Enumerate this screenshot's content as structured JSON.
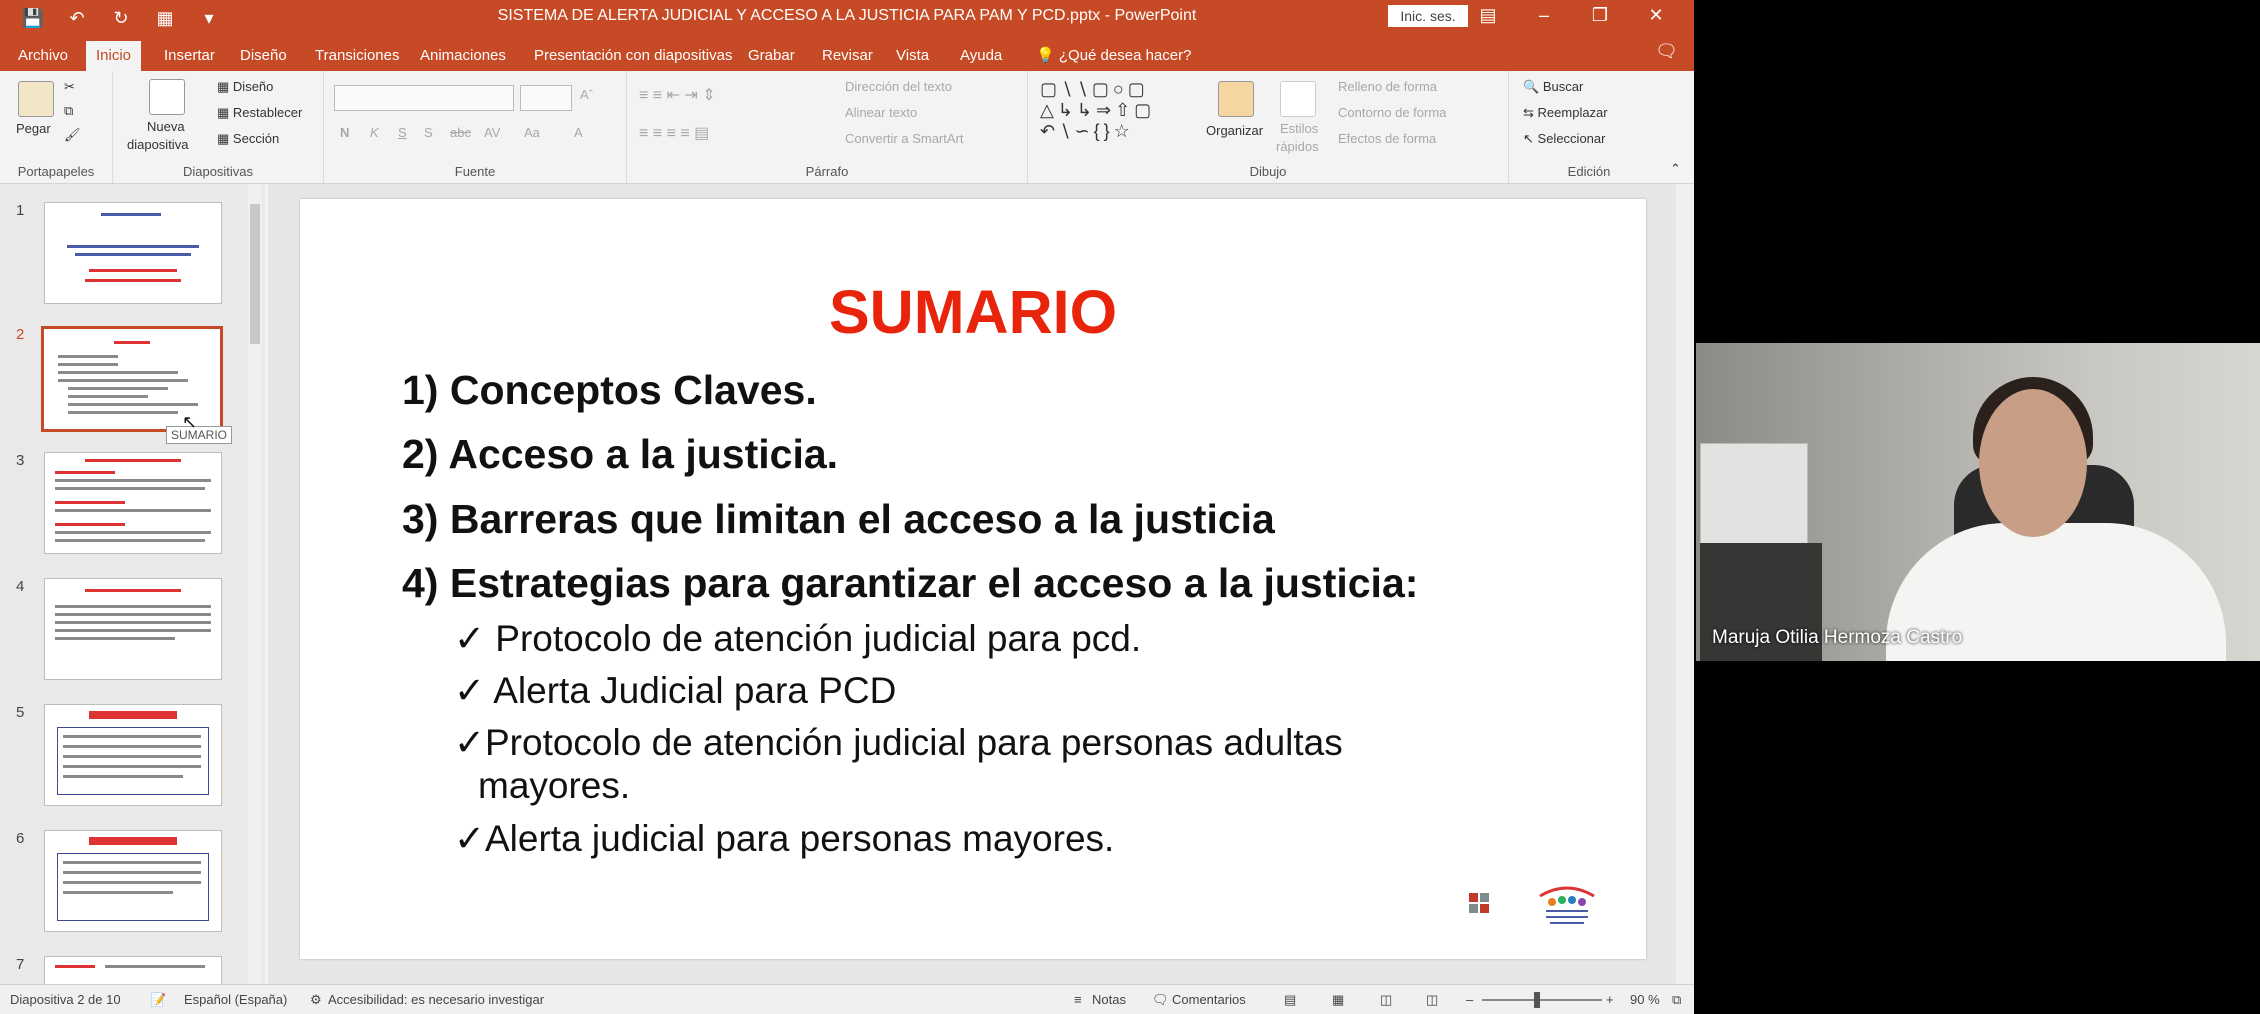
{
  "window": {
    "title": "SISTEMA DE ALERTA JUDICIAL Y ACCESO A LA JUSTICIA PARA PAM Y  PCD.pptx  -  PowerPoint",
    "signin": "Inic. ses.",
    "qat_icons": [
      "save-icon",
      "undo-icon",
      "redo-icon",
      "start-slideshow-icon",
      "customize-icon"
    ]
  },
  "tabs": {
    "items": [
      "Archivo",
      "Inicio",
      "Insertar",
      "Diseño",
      "Transiciones",
      "Animaciones",
      "Presentación con diapositivas",
      "Grabar",
      "Revisar",
      "Vista",
      "Ayuda"
    ],
    "active": "Inicio",
    "tell_me": "¿Qué desea hacer?"
  },
  "ribbon": {
    "portapapeles": {
      "label": "Portapapeles",
      "paste": "Pegar"
    },
    "diapositivas": {
      "label": "Diapositivas",
      "new_slide_1": "Nueva",
      "new_slide_2": "diapositiva",
      "layout": "Diseño",
      "reset": "Restablecer",
      "section": "Sección"
    },
    "fuente": {
      "label": "Fuente",
      "buttons": [
        "N",
        "K",
        "S",
        "S",
        "abc",
        "AV",
        "Aa",
        "A"
      ]
    },
    "parrafo": {
      "label": "Párrafo",
      "direction": "Dirección del texto",
      "align": "Alinear texto",
      "smartart": "Convertir a SmartArt"
    },
    "dibujo": {
      "label": "Dibujo",
      "arrange": "Organizar",
      "styles_1": "Estilos",
      "styles_2": "rápidos",
      "fill": "Relleno de forma",
      "outline": "Contorno de forma",
      "effects": "Efectos de forma"
    },
    "edicion": {
      "label": "Edición",
      "find": "Buscar",
      "replace": "Reemplazar",
      "select": "Seleccionar"
    }
  },
  "thumbnails": {
    "numbers": [
      "1",
      "2",
      "3",
      "4",
      "5",
      "6",
      "7"
    ],
    "selected": 2,
    "tooltip": "SUMARIO"
  },
  "slide": {
    "title": "SUMARIO",
    "items": [
      {
        "num": "1)",
        "text": "Conceptos Claves."
      },
      {
        "num": "2)",
        "text": "Acceso a la justicia."
      },
      {
        "num": "3)",
        "text": "Barreras que limitan el acceso a la justicia"
      },
      {
        "num": "4)",
        "text": "Estrategias para garantizar el acceso a la justicia:"
      }
    ],
    "bullets": [
      "✓  Protocolo de atención judicial para pcd.",
      "✓  Alerta Judicial para PCD",
      "✓Protocolo de atención judicial para personas adultas",
      "mayores.",
      "✓Alerta judicial para personas mayores."
    ]
  },
  "status": {
    "slide_count": "Diapositiva 2 de 10",
    "language": "Español (España)",
    "accessibility": "Accesibilidad: es necesario investigar",
    "notes": "Notas",
    "comments": "Comentarios",
    "zoom": "90 %"
  },
  "video": {
    "participant_name": "Maruja Otilia Hermoza Castro"
  },
  "colors": {
    "accent": "#c64a25",
    "slide_title": "#e8240c"
  }
}
